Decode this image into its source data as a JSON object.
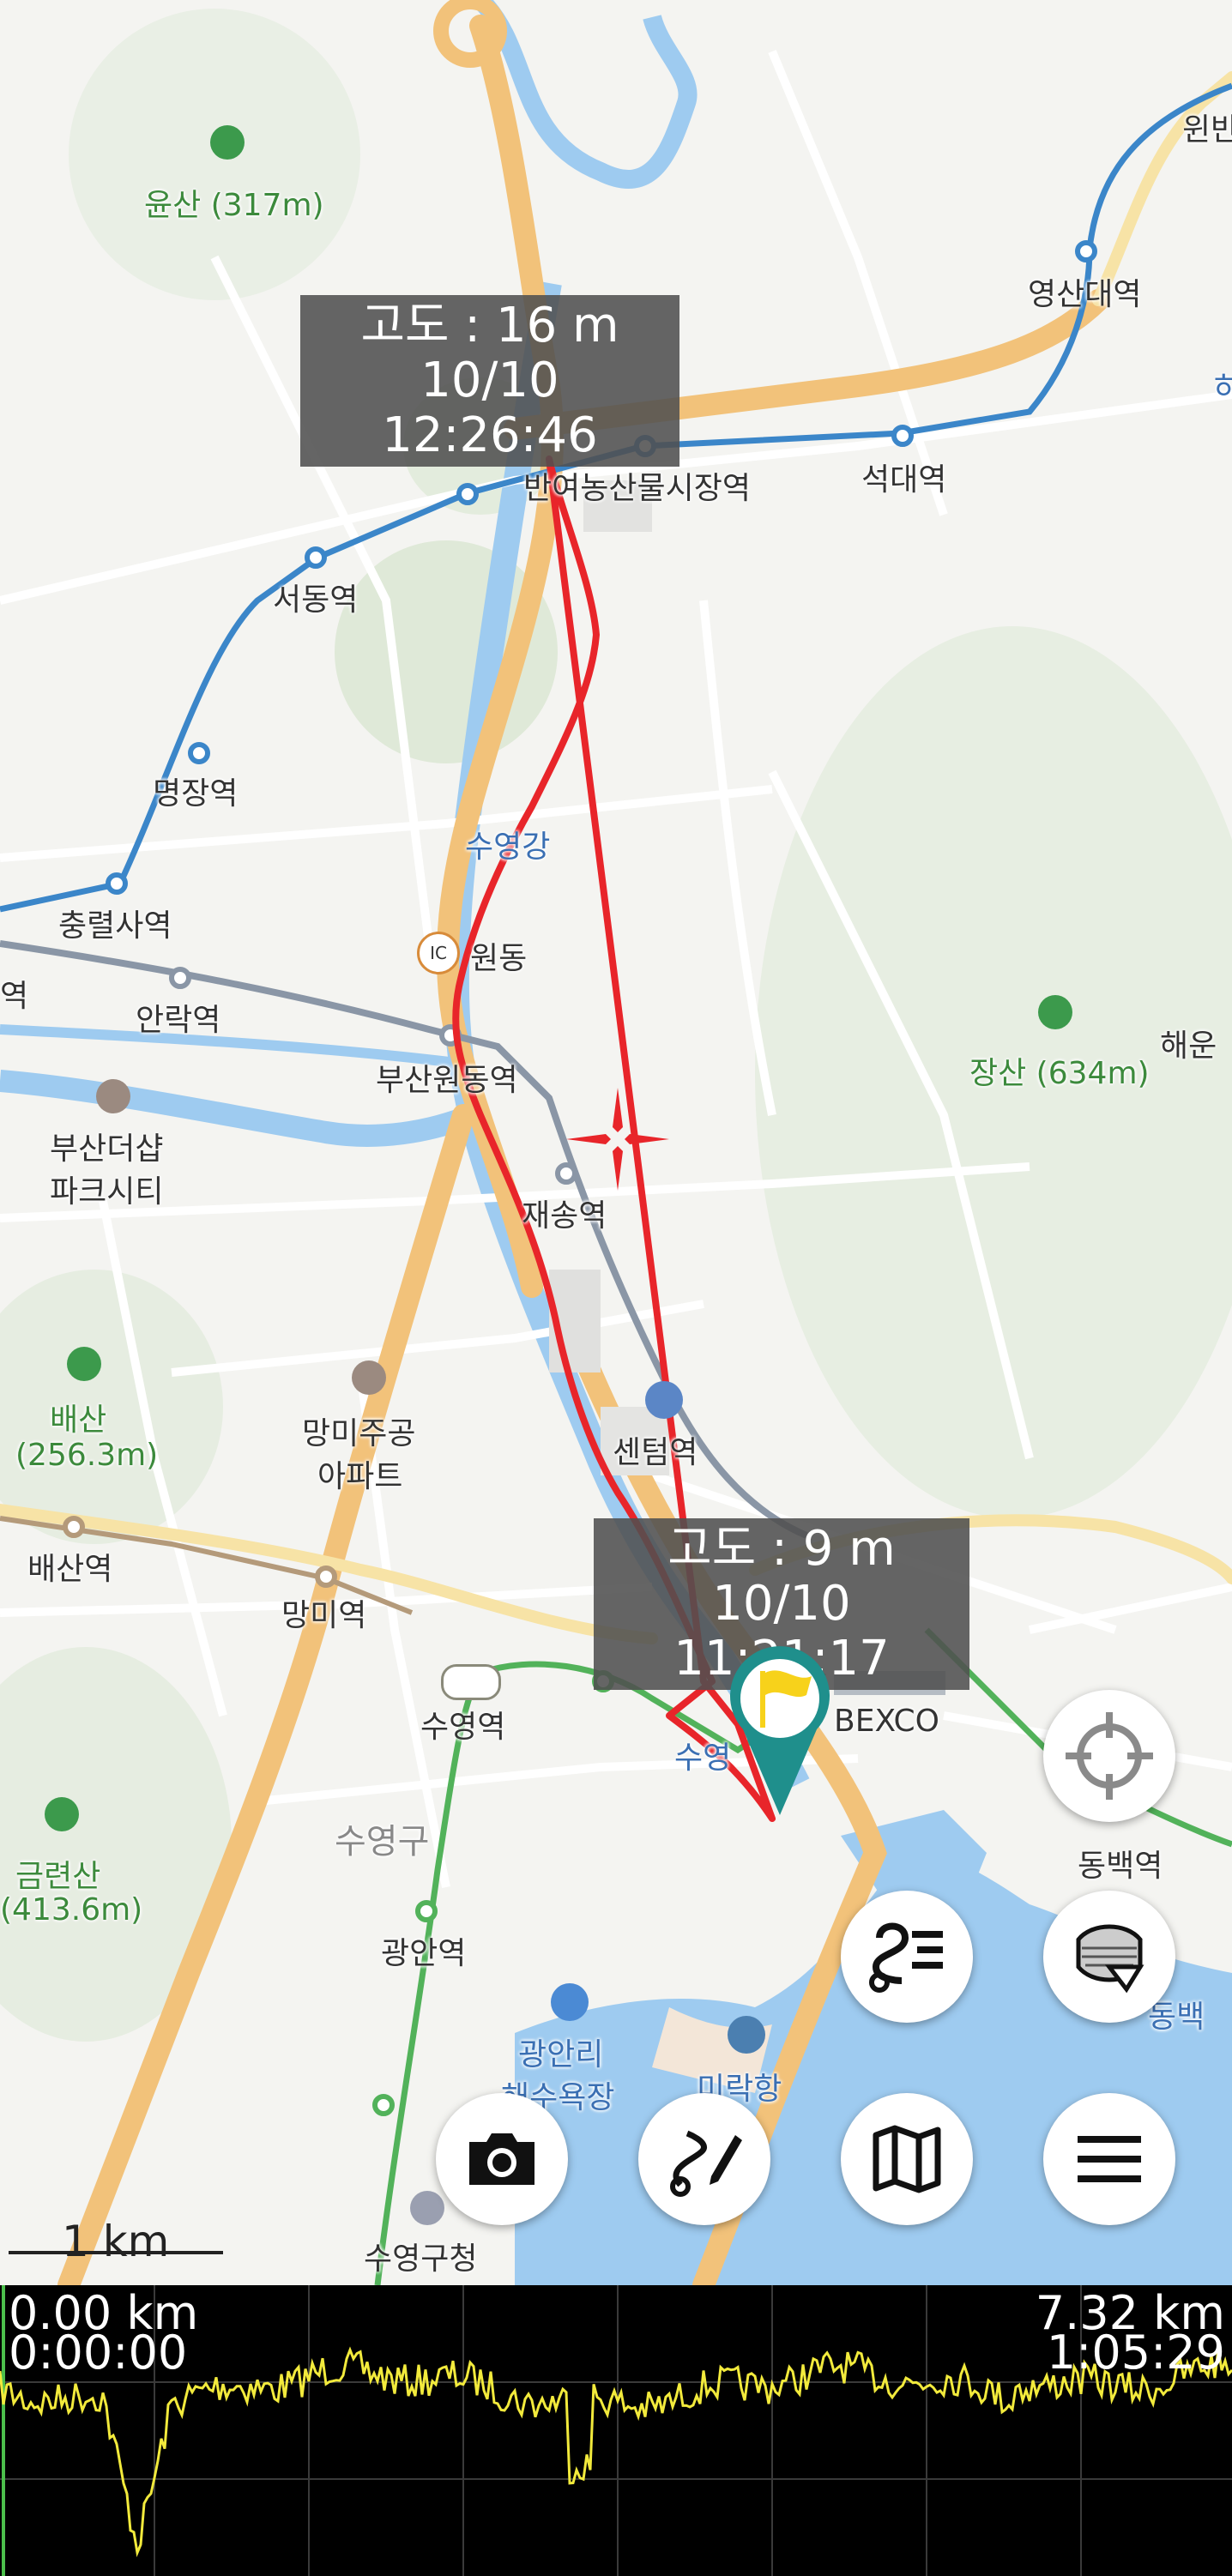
{
  "map": {
    "place_labels": {
      "yunsan": "윤산 (317m)",
      "woonban": "윈반",
      "seodong_station": "서동역",
      "myeongjang_station": "명장역",
      "chungnyeolsa_station": "충렬사역",
      "anrak_station": "안락역",
      "left_edge_station": "역",
      "busan_the_sharp_l1": "부산더샵",
      "busan_the_sharp_l2": "파크시티",
      "suyeong_river": "수영강",
      "wondong": "원동",
      "ic": "IC",
      "busan_wondong_station": "부산원동역",
      "jaesong_station": "재송역",
      "bansong_market_station": "반여농산물시장역",
      "seokdae_station": "석대역",
      "yeongsan_univ_station": "영산대역",
      "jangsan": "장산 (634m)",
      "haeun": "해운",
      "baesan_l1": "배산",
      "baesan_l2": "(256.3m)",
      "mangmi_apt_l1": "망미주공",
      "mangmi_apt_l2": "아파트",
      "centum_station": "센텀역",
      "baesan_station": "배산역",
      "mangmi_station": "망미역",
      "suyeong_station": "수영역",
      "suyeong_gu": "수영구",
      "suyeong_partial": "수영",
      "bexco": "BEXCO",
      "geumnyeonsan_l1": "금련산",
      "geumnyeonsan_l2": "(413.6m)",
      "gwangan_station": "광안역",
      "gwangalli_l1": "광안리",
      "gwangalli_l2": "해수욕장",
      "millak_port": "미락항",
      "dongbaek_station": "동백역",
      "dongbaek_partial": "동백",
      "suyeong_office": "수영구청",
      "right_edge_partial": "히"
    },
    "callouts": {
      "end_altitude": "고도 : 16 m",
      "end_time": "10/10 12:26:46",
      "start_altitude": "고도 : 9 m",
      "start_time": "10/10 11:21:17"
    },
    "scale": "1 km",
    "colors": {
      "track": "#e8252a",
      "road_major": "#f2c27a",
      "subway_blue": "#3b86c9",
      "subway_green": "#52b25a",
      "water": "#9ecbf0",
      "marker": "#1f8f8c",
      "flag": "#f7d21b"
    }
  },
  "buttons": {
    "locate": "crosshair-icon",
    "layers": "layers-icon",
    "route": "route-list-icon",
    "camera": "camera-icon",
    "draw_route": "draw-route-icon",
    "map": "map-icon",
    "menu": "menu-icon"
  },
  "profile": {
    "start_distance": "0.00 km",
    "start_time": "0:00:00",
    "end_distance": "7.32 km",
    "end_time": "1:05:29",
    "line_color": "#f2ea3c"
  }
}
